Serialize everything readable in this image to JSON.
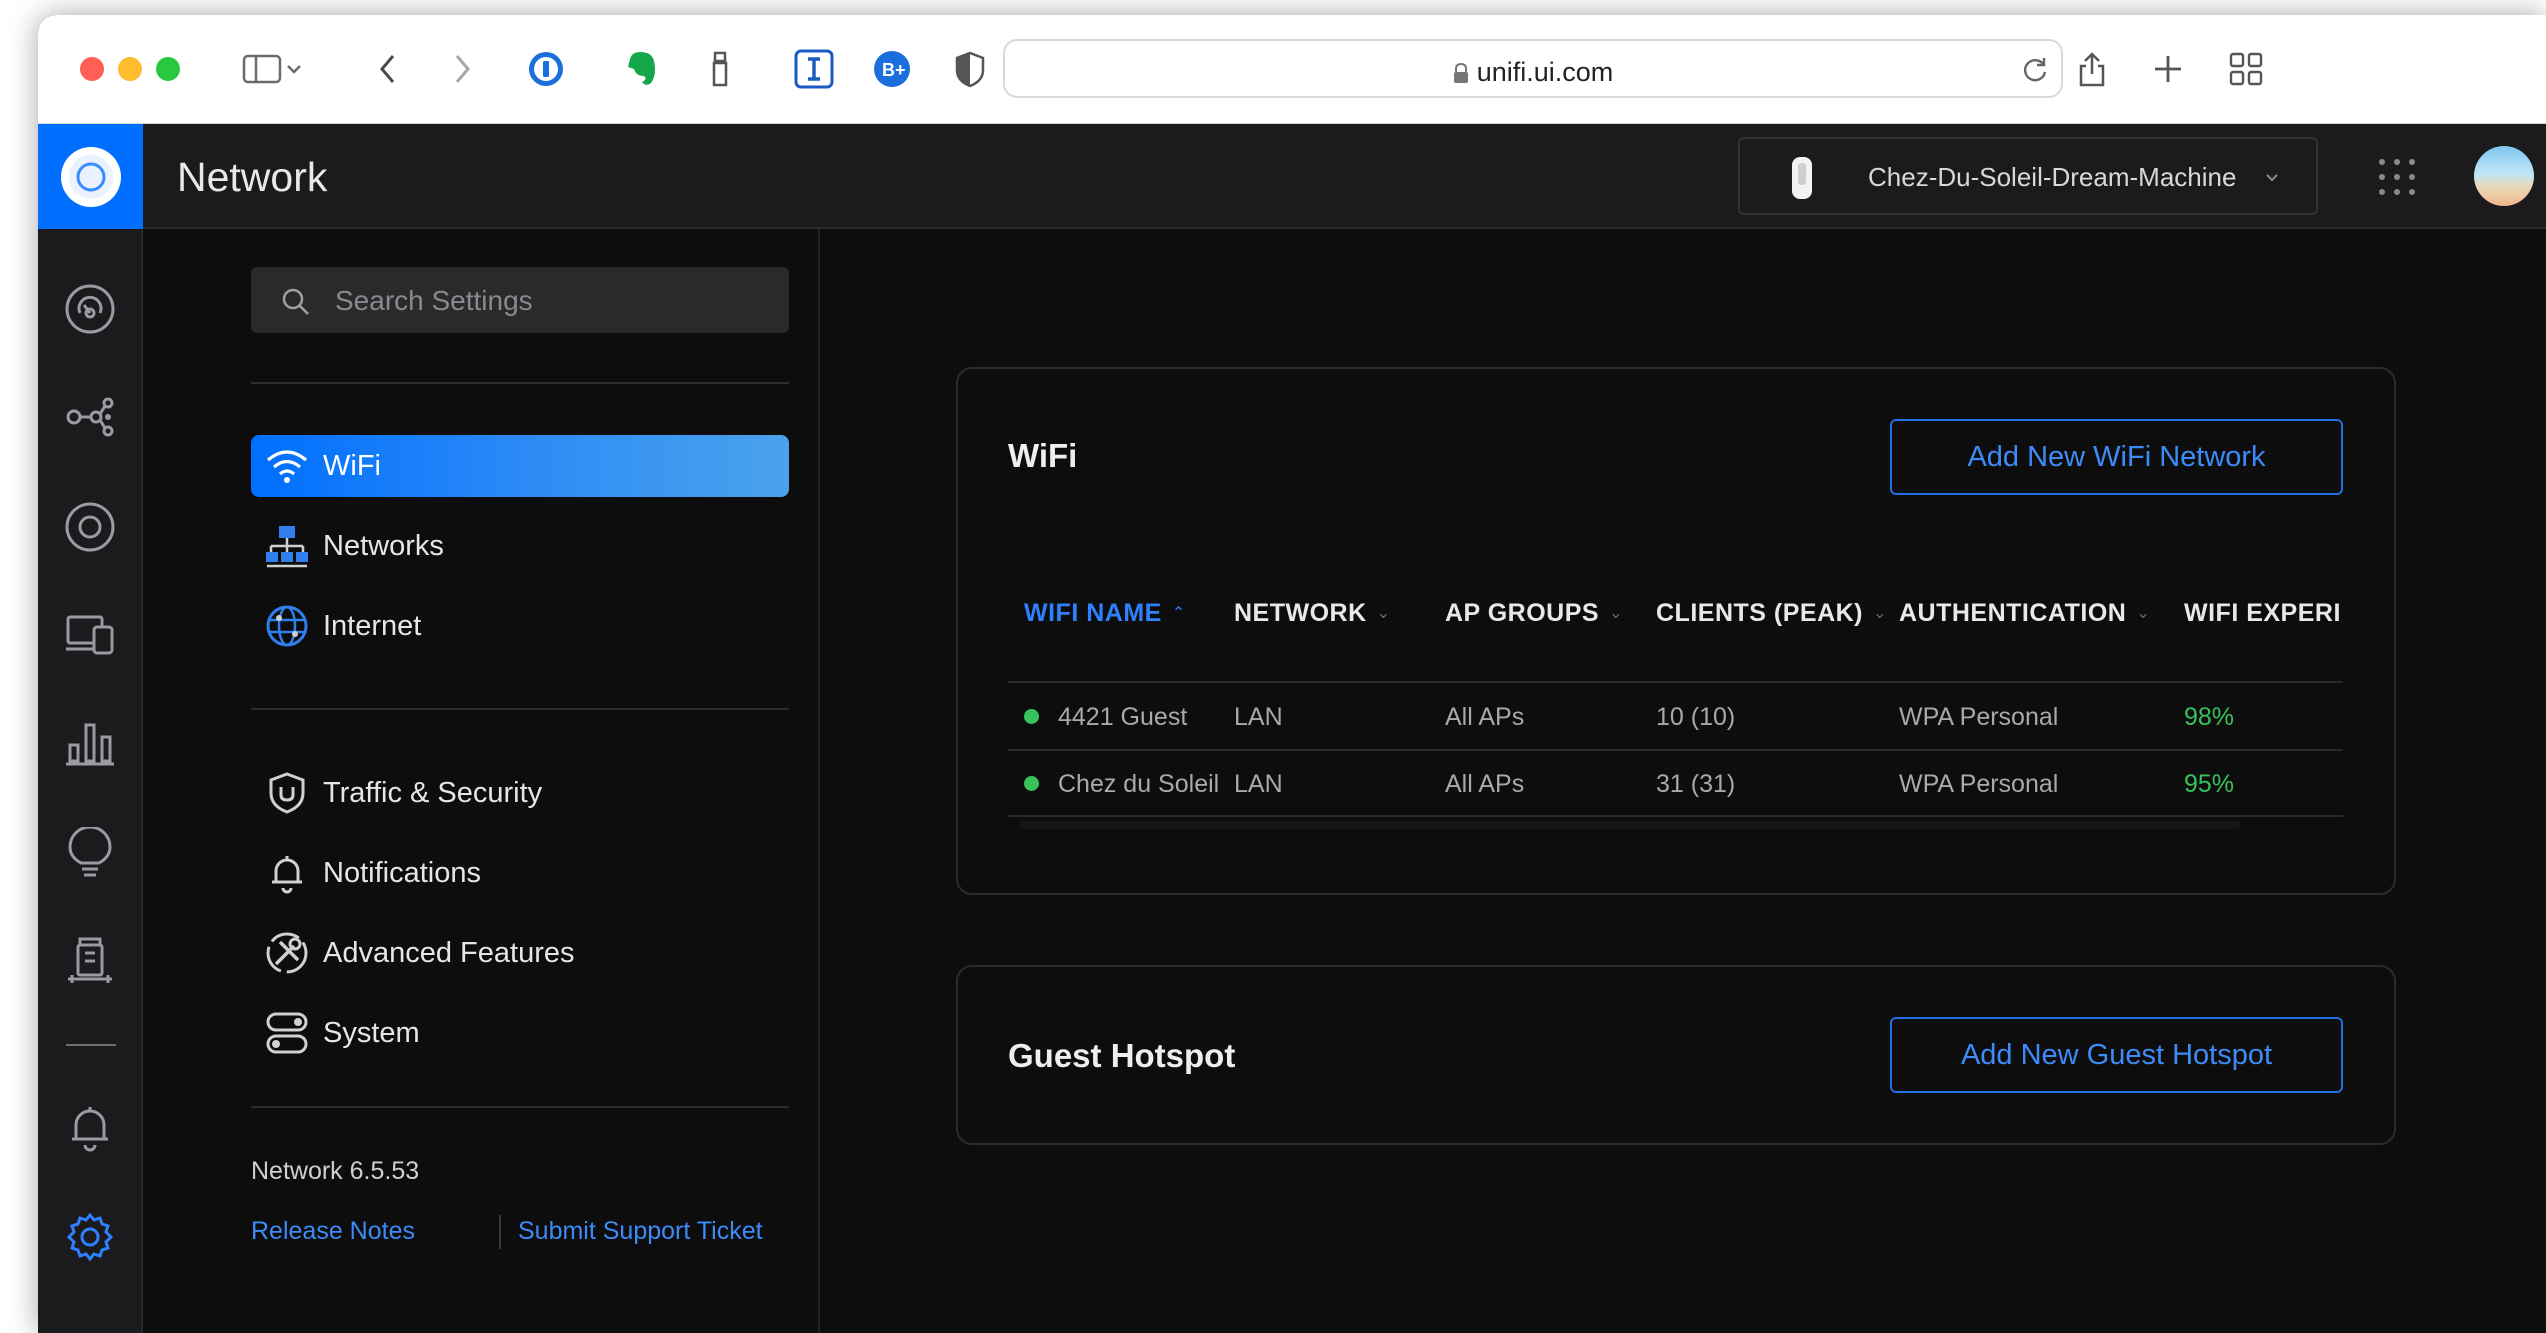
{
  "browser": {
    "url": "unifi.ui.com",
    "traffic_lights": [
      "#ff5f57",
      "#febc2e",
      "#28c840"
    ]
  },
  "header": {
    "app_title": "Network",
    "device_name": "Chez-Du-Soleil-Dream-Machine"
  },
  "colors": {
    "accent": "#006fff",
    "link": "#3d8bf8",
    "status_green": "#38c25b",
    "background": "#0d0d0d"
  },
  "rail": {
    "icons": [
      "dashboard-icon",
      "topology-icon",
      "devices-icon",
      "clients-icon",
      "statistics-icon",
      "insights-icon",
      "system-log-icon",
      "notifications-icon",
      "settings-icon"
    ]
  },
  "settings_nav": {
    "search_placeholder": "Search Settings",
    "items": [
      {
        "label": "WiFi",
        "icon": "wifi-icon",
        "active": true
      },
      {
        "label": "Networks",
        "icon": "networks-icon"
      },
      {
        "label": "Internet",
        "icon": "internet-globe-icon"
      },
      {
        "label": "Traffic & Security",
        "icon": "shield-icon"
      },
      {
        "label": "Notifications",
        "icon": "bell-icon"
      },
      {
        "label": "Advanced Features",
        "icon": "advanced-features-icon"
      },
      {
        "label": "System",
        "icon": "toggles-icon"
      }
    ],
    "version": "Network 6.5.53",
    "release_notes": "Release Notes",
    "support_ticket": "Submit Support Ticket"
  },
  "wifi_card": {
    "title": "WiFi",
    "add_button": "Add New WiFi Network",
    "columns": [
      "WIFI NAME",
      "NETWORK",
      "AP GROUPS",
      "CLIENTS (PEAK)",
      "AUTHENTICATION",
      "WIFI EXPERI"
    ],
    "rows": [
      {
        "name": "4421 Guest",
        "network": "LAN",
        "ap_groups": "All APs",
        "clients": "10 (10)",
        "auth": "WPA Personal",
        "experience": "98%"
      },
      {
        "name": "Chez du Soleil",
        "network": "LAN",
        "ap_groups": "All APs",
        "clients": "31 (31)",
        "auth": "WPA Personal",
        "experience": "95%"
      }
    ]
  },
  "hotspot_card": {
    "title": "Guest Hotspot",
    "add_button": "Add New Guest Hotspot"
  }
}
